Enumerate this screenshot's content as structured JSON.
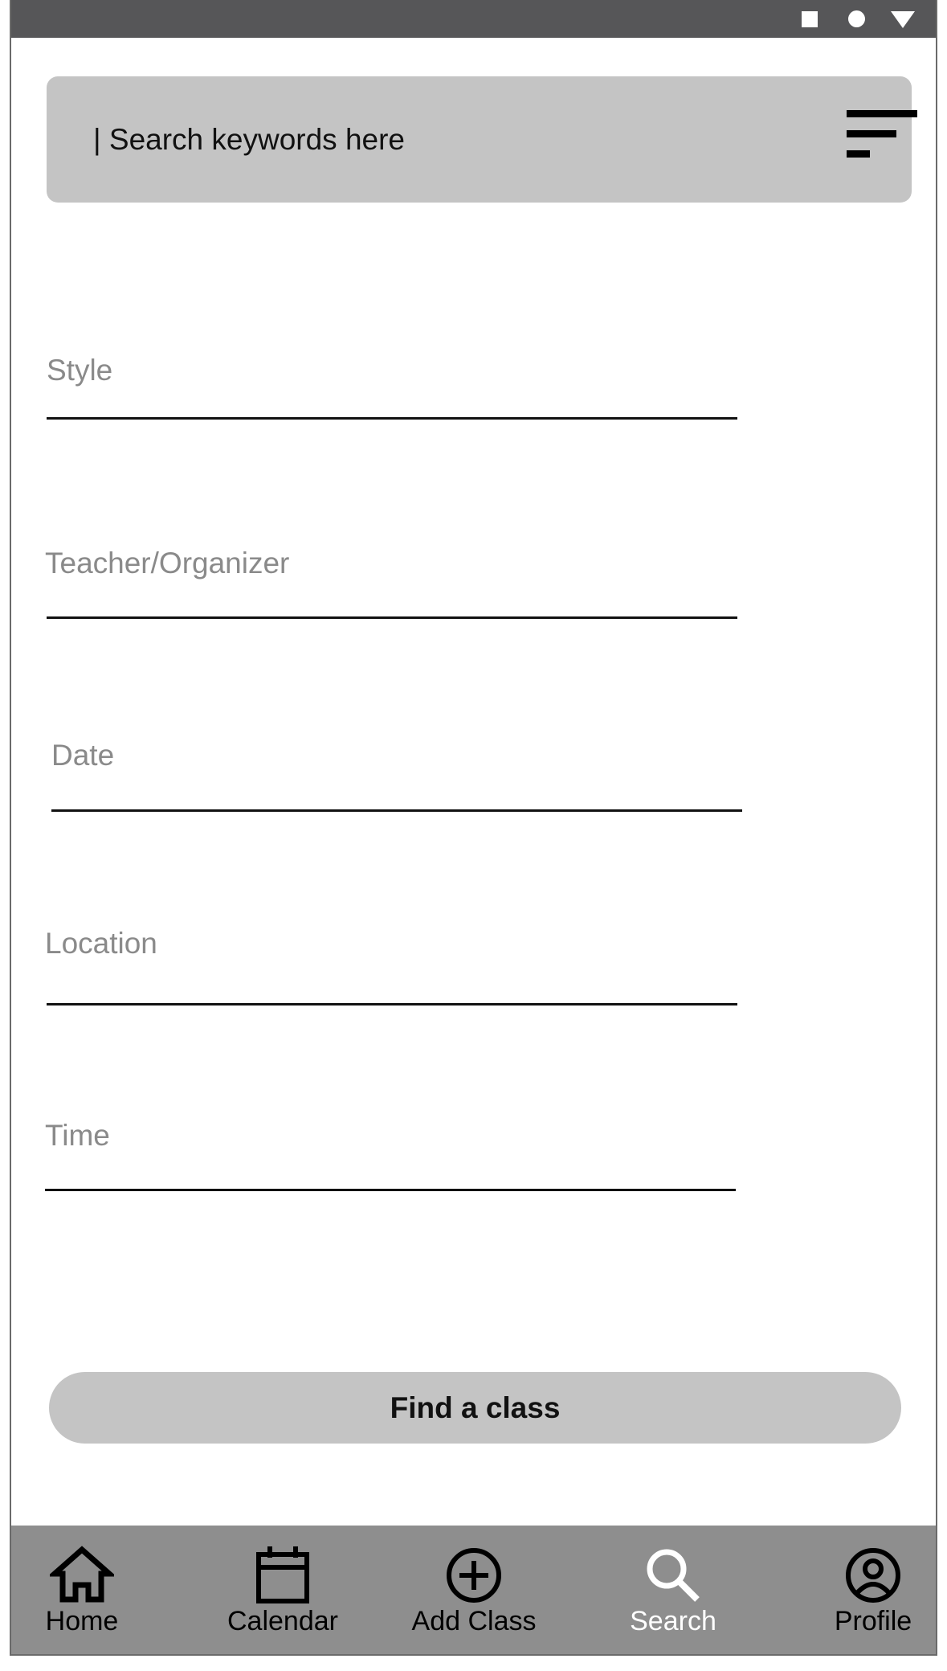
{
  "status_bar": {
    "icons": [
      "square-icon",
      "circle-icon",
      "triangle-down-icon"
    ]
  },
  "search": {
    "placeholder": "| Search keywords here",
    "filter_icon": "filter-sort-icon"
  },
  "form": {
    "fields": [
      {
        "label": "Style"
      },
      {
        "label": "Teacher/Organizer"
      },
      {
        "label": "Date"
      },
      {
        "label": "Location"
      },
      {
        "label": "Time"
      }
    ],
    "submit_label": "Find a class"
  },
  "nav": {
    "items": [
      {
        "label": "Home",
        "icon": "home-icon",
        "active": false
      },
      {
        "label": "Calendar",
        "icon": "calendar-icon",
        "active": false
      },
      {
        "label": "Add Class",
        "icon": "add-circle-icon",
        "active": false
      },
      {
        "label": "Search",
        "icon": "search-icon",
        "active": true
      },
      {
        "label": "Profile",
        "icon": "profile-icon",
        "active": false
      }
    ]
  },
  "colors": {
    "status_bar": "#565658",
    "search_bg": "#c4c4c4",
    "button_bg": "#c4c4c4",
    "nav_bg": "#8e8e8e",
    "label_gray": "#8a8a8a",
    "active_nav": "#ffffff"
  }
}
